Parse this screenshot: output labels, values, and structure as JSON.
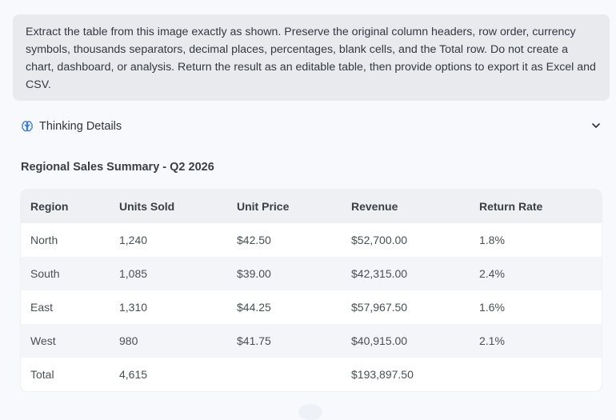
{
  "prompt": {
    "text": "Extract the table from this image exactly as shown. Preserve the original column headers, row order, currency symbols, thousands separators, decimal places, percentages, blank cells, and the Total row. Do not create a chart, dashboard, or analysis. Return the result as an editable table, then provide options to export it as Excel and CSV."
  },
  "thinking": {
    "label": "Thinking Details",
    "icon": "brain-icon",
    "toggle_icon": "chevron-down-icon",
    "accent": "#3a7bd5"
  },
  "table": {
    "title": "Regional Sales Summary - Q2 2026",
    "headers": [
      "Region",
      "Units Sold",
      "Unit Price",
      "Revenue",
      "Return Rate"
    ],
    "rows": [
      [
        "North",
        "1,240",
        "$42.50",
        "$52,700.00",
        "1.8%"
      ],
      [
        "South",
        "1,085",
        "$39.00",
        "$42,315.00",
        "2.4%"
      ],
      [
        "East",
        "1,310",
        "$44.25",
        "$57,967.50",
        "1.6%"
      ],
      [
        "West",
        "980",
        "$41.75",
        "$40,915.00",
        "2.1%"
      ],
      [
        "Total",
        "4,615",
        "",
        "$193,897.50",
        ""
      ]
    ]
  }
}
